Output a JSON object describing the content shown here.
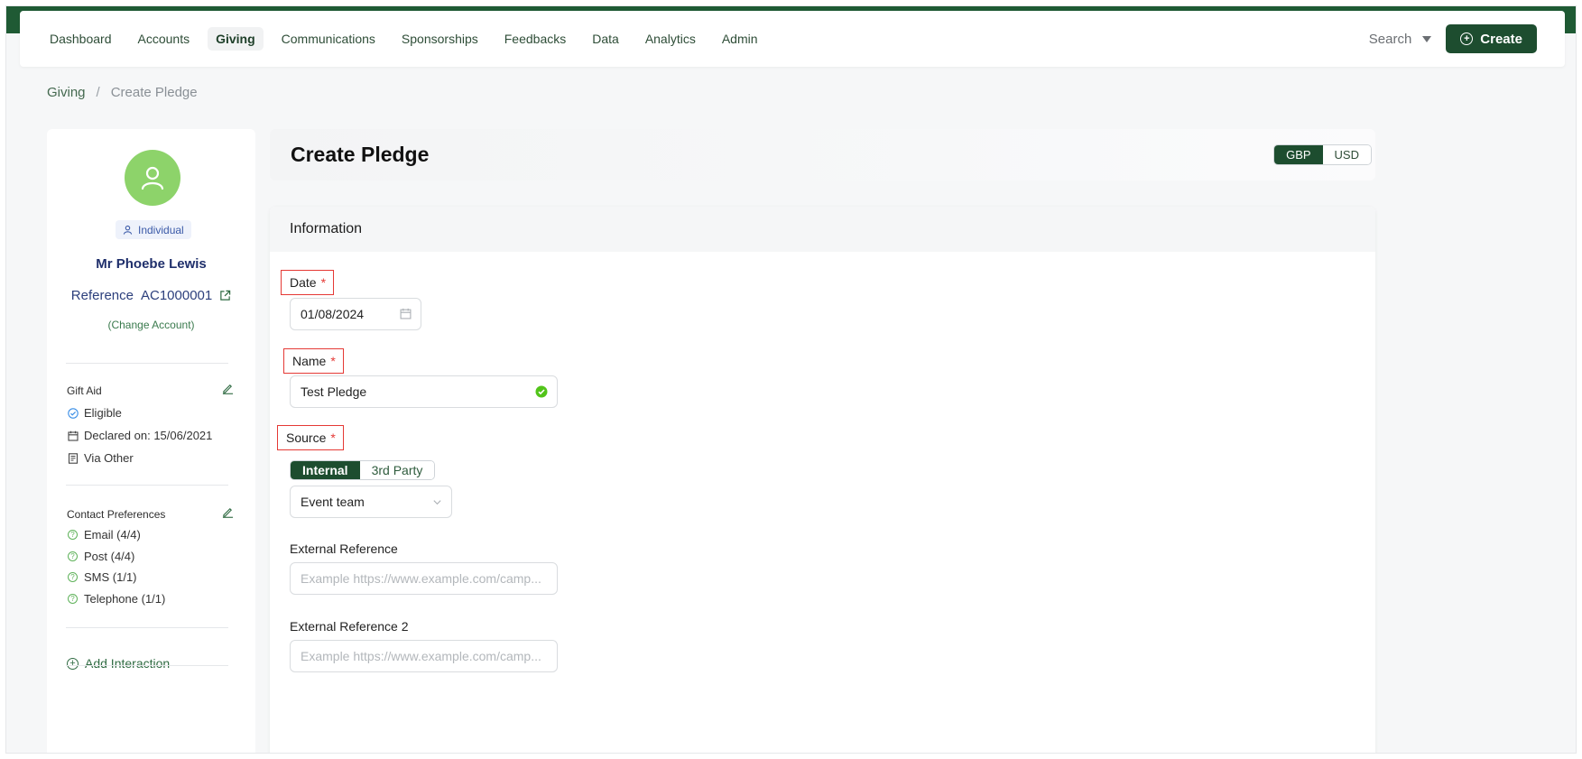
{
  "nav": {
    "items": [
      "Dashboard",
      "Accounts",
      "Giving",
      "Communications",
      "Sponsorships",
      "Feedbacks",
      "Data",
      "Analytics",
      "Admin"
    ],
    "active": "Giving",
    "search_label": "Search",
    "create_label": "Create"
  },
  "breadcrumb": {
    "parent": "Giving",
    "separator": "/",
    "current": "Create Pledge"
  },
  "account": {
    "type_badge": "Individual",
    "name": "Mr Phoebe Lewis",
    "reference_label": "Reference",
    "reference_value": "AC1000001",
    "change_link": "(Change Account)"
  },
  "gift_aid": {
    "title": "Gift Aid",
    "status": "Eligible",
    "declared": "Declared on: 15/06/2021",
    "via": "Via Other"
  },
  "contact_preferences": {
    "title": "Contact Preferences",
    "items": [
      "Email (4/4)",
      "Post (4/4)",
      "SMS (1/1)",
      "Telephone (1/1)"
    ]
  },
  "add_interaction": "Add Interaction",
  "page": {
    "title": "Create Pledge",
    "currency": {
      "options": [
        "GBP",
        "USD"
      ],
      "selected": "GBP"
    }
  },
  "form": {
    "section_title": "Information",
    "date": {
      "label": "Date",
      "required": "*",
      "value": "01/08/2024"
    },
    "name": {
      "label": "Name",
      "required": "*",
      "value": "Test Pledge"
    },
    "source": {
      "label": "Source",
      "required": "*",
      "options": [
        "Internal",
        "3rd Party"
      ],
      "selected": "Internal",
      "team_value": "Event team"
    },
    "external_reference": {
      "label": "External Reference",
      "placeholder": "Example https://www.example.com/camp..."
    },
    "external_reference_2": {
      "label": "External Reference 2",
      "placeholder": "Example https://www.example.com/camp..."
    }
  },
  "colors": {
    "brand_green": "#1d4d2f",
    "avatar_green": "#8dd36a",
    "required_red": "#e53935"
  }
}
